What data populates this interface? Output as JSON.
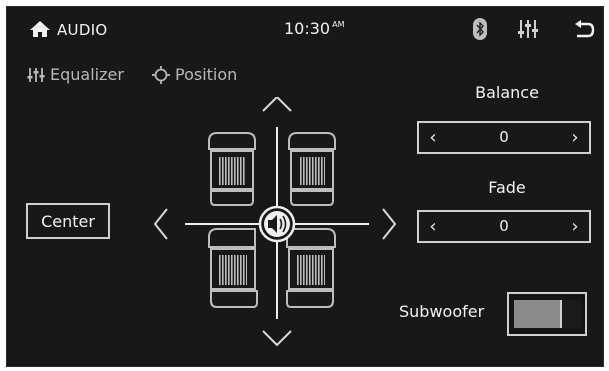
{
  "status_bar": {
    "title": "AUDIO",
    "time": "10:30",
    "ampm": "AM",
    "icons": [
      "home-icon",
      "bluetooth-icon",
      "equalizer-icon",
      "back-icon"
    ]
  },
  "tabs": [
    {
      "label": "Equalizer",
      "icon": "equalizer-icon"
    },
    {
      "label": "Position",
      "icon": "crosshair-icon"
    }
  ],
  "position": {
    "center_label": "Center",
    "balance_label": "Balance",
    "balance_value": "0",
    "fade_label": "Fade",
    "fade_value": "0",
    "subwoofer_label": "Subwoofer",
    "subwoofer_on": true
  },
  "colors": {
    "background": "#181818",
    "foreground": "#e6e6e6",
    "toggle_fill": "#8a8a8a"
  }
}
